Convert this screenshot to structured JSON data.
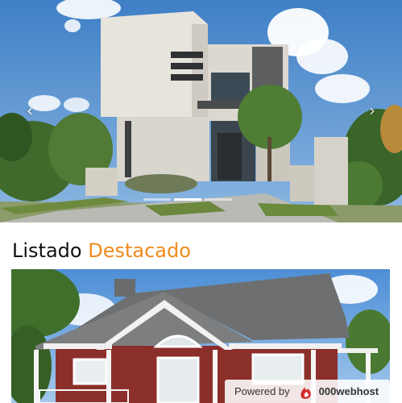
{
  "hero": {
    "prev_icon": "‹",
    "next_icon": "›",
    "slide_count": 3,
    "active_slide": 1
  },
  "section": {
    "title_part1": "Listado",
    "title_part2": "Destacado",
    "accent_color": "#f08a1c"
  },
  "footer_badge": {
    "powered_text": "Powered by",
    "brand_text": "000webhost",
    "logo_icon": "000webhost-flame-logo",
    "logo_color": "#d22b2b"
  }
}
